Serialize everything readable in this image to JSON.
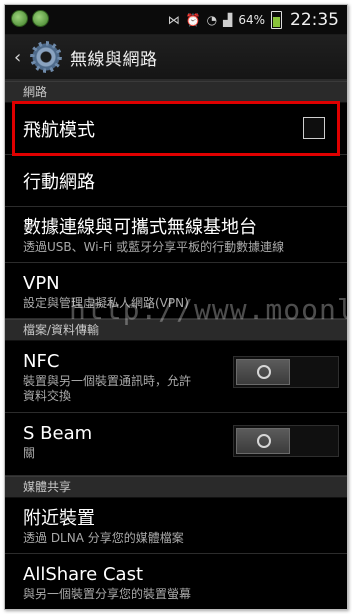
{
  "status_bar": {
    "icons": [
      "vibrate-icon",
      "alarm-icon",
      "wifi-icon",
      "signal-icon"
    ],
    "battery": "64%",
    "time": "22:35"
  },
  "action_bar": {
    "back_icon": "chevron-left-icon",
    "app_icon": "gear-icon",
    "title": "無線與網路"
  },
  "sections": {
    "network": "網路",
    "files": "檔案/資料傳輸",
    "media": "媒體共享"
  },
  "items": {
    "airplane": {
      "label": "飛航模式",
      "checked": false
    },
    "mobile": {
      "label": "行動網路"
    },
    "tethering": {
      "label": "數據連線與可攜式無線基地台",
      "summary": "透過USB、Wi-Fi 或藍牙分享平板的行動數據連線"
    },
    "vpn": {
      "label": "VPN",
      "summary": "設定與管理虛擬私人網路(VPN)"
    },
    "nfc": {
      "label": "NFC",
      "summary_line1": "裝置與另一個裝置通訊時，允許",
      "summary_line2": "資料交換",
      "enabled": false
    },
    "sbeam": {
      "label": "S Beam",
      "summary": "關",
      "enabled": false
    },
    "nearby": {
      "label": "附近裝置",
      "summary": "透過 DLNA 分享您的媒體檔案"
    },
    "allshare": {
      "label": "AllShare Cast",
      "summary": "與另一個裝置分享您的裝置螢幕"
    }
  },
  "watermark": "http://www.moonlit.tw",
  "colors": {
    "highlight": "#e00000",
    "battery": "#88c23a"
  }
}
